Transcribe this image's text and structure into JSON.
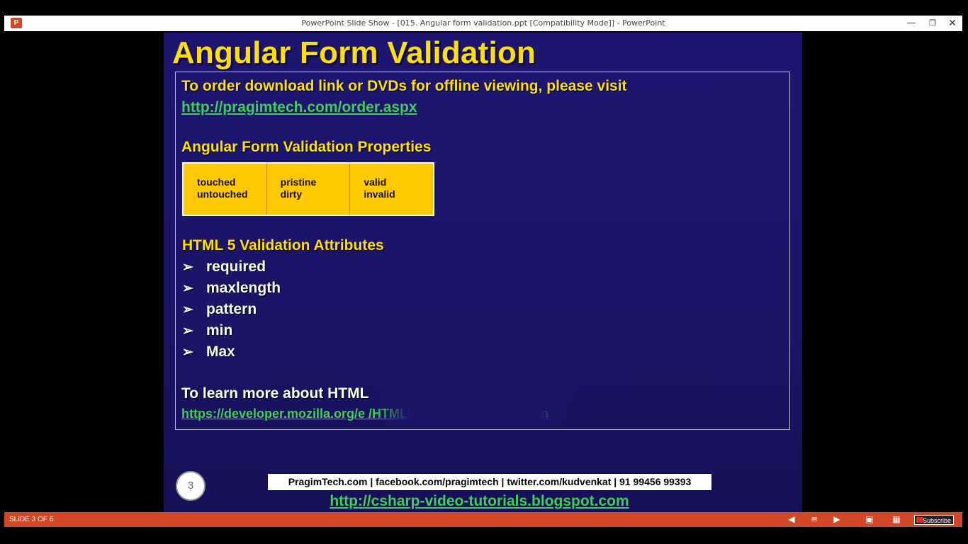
{
  "window": {
    "app_icon": "P",
    "title": "PowerPoint Slide Show - [015. Angular form validation.ppt [Compatibility Mode]] - PowerPoint",
    "controls": {
      "minimize": "—",
      "restore": "❒",
      "close": "✕"
    }
  },
  "slide": {
    "title": "Angular Form Validation",
    "order_text": "To order download link or DVDs for offline viewing, please visit",
    "order_link": "http://pragimtech.com/order.aspx",
    "properties_heading": "Angular Form Validation Properties",
    "properties": [
      {
        "line1": "touched",
        "line2": "untouched"
      },
      {
        "line1": "pristine",
        "line2": "dirty"
      },
      {
        "line1": "valid",
        "line2": "invalid"
      }
    ],
    "attributes_heading": "HTML 5 Validation Attributes",
    "bullet_glyph": "➢",
    "attributes": [
      "required",
      "maxlength",
      "pattern",
      "min",
      "Max"
    ],
    "learn_more_text": "To learn more about HTML",
    "learn_more_link": "https://developer.mozilla.org/e                                             /HTML5/Constraint_validation",
    "slide_number": "3",
    "footer_contact": "PragimTech.com | facebook.com/pragimtech | twitter.com/kudvenkat | 91 99456 99393",
    "footer_link": "http://csharp-video-tutorials.blogspot.com"
  },
  "statusbar": {
    "slide_counter": "SLIDE 3 OF 6",
    "icons": {
      "prev": "◀",
      "notes": "≡",
      "next": "▶",
      "reading": "▣",
      "grid": "▦"
    },
    "subscribe_label": "Subscribe"
  },
  "colors": {
    "accent_title": "#ffe000",
    "link": "#3ecf5a",
    "slide_bg": "#1e1571",
    "statusbar": "#d24726",
    "table_fill": "#ffc800"
  }
}
